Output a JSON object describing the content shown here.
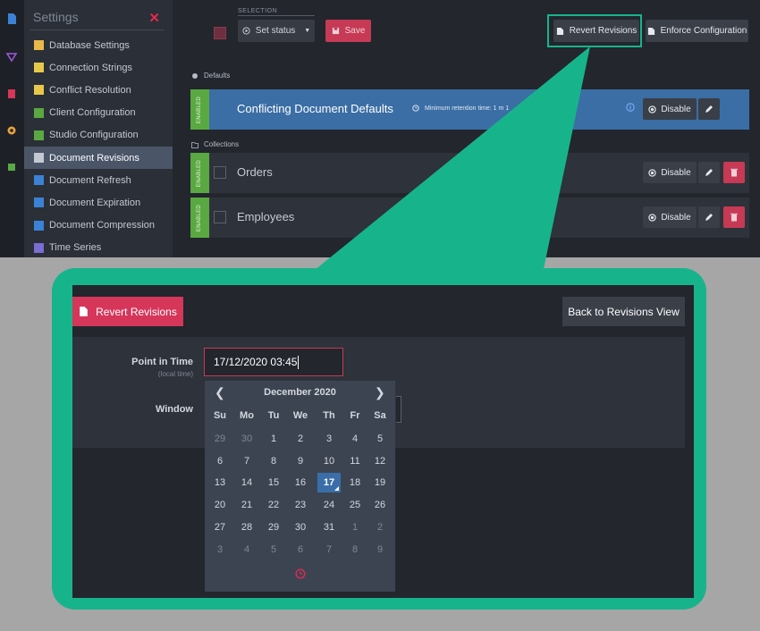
{
  "colors": {
    "accent_green": "#17b48c",
    "danger": "#d5365a",
    "enabled_green": "#5aa842",
    "selected_blue": "#3b6ea5",
    "bg_dark": "#23262d"
  },
  "settings_menu": {
    "title": "Settings",
    "close_icon": "close-icon",
    "items": [
      {
        "label": "Database Settings",
        "icon": "database-icon",
        "color": "#e8b84a"
      },
      {
        "label": "Connection Strings",
        "icon": "connection-icon",
        "color": "#e8c84a"
      },
      {
        "label": "Conflict Resolution",
        "icon": "conflict-icon",
        "color": "#e8c84a"
      },
      {
        "label": "Client Configuration",
        "icon": "client-icon",
        "color": "#5aa842"
      },
      {
        "label": "Studio Configuration",
        "icon": "studio-icon",
        "color": "#5aa842"
      },
      {
        "label": "Document Revisions",
        "icon": "revisions-icon",
        "color": "#c3c9d1",
        "active": true
      },
      {
        "label": "Document Refresh",
        "icon": "refresh-icon",
        "color": "#3b82d6"
      },
      {
        "label": "Document Expiration",
        "icon": "expiration-icon",
        "color": "#3b82d6"
      },
      {
        "label": "Document Compression",
        "icon": "compression-icon",
        "color": "#3b82d6"
      },
      {
        "label": "Time Series",
        "icon": "timeseries-icon",
        "color": "#7b6cd6"
      }
    ]
  },
  "toolbar": {
    "selection_label": "SELECTION",
    "set_status_label": "Set status",
    "save_label": "Save",
    "revert_revisions_label": "Revert Revisions",
    "enforce_configuration_label": "Enforce Configuration"
  },
  "defaults_section": {
    "label": "Defaults",
    "row": {
      "status": "ENABLED",
      "title": "Conflicting Document Defaults",
      "retention": "Minimum retention time: 1 m 1",
      "disable_label": "Disable"
    }
  },
  "collections_section": {
    "label": "Collections",
    "rows": [
      {
        "status": "ENABLED",
        "title": "Orders",
        "disable_label": "Disable"
      },
      {
        "status": "ENABLED",
        "title": "Employees",
        "disable_label": "Disable"
      }
    ]
  },
  "revert_view": {
    "revert_button_label": "Revert Revisions",
    "back_button_label": "Back to Revisions View",
    "point_in_time_label": "Point in Time",
    "point_in_time_sublabel": "(local time)",
    "point_in_time_value": "17/12/2020 03:45",
    "window_label": "Window"
  },
  "calendar": {
    "month_label": "December 2020",
    "weekdays": [
      "Su",
      "Mo",
      "Tu",
      "We",
      "Th",
      "Fr",
      "Sa"
    ],
    "weeks": [
      [
        {
          "d": "29",
          "m": true
        },
        {
          "d": "30",
          "m": true
        },
        {
          "d": "1"
        },
        {
          "d": "2"
        },
        {
          "d": "3"
        },
        {
          "d": "4"
        },
        {
          "d": "5"
        }
      ],
      [
        {
          "d": "6"
        },
        {
          "d": "7"
        },
        {
          "d": "8"
        },
        {
          "d": "9"
        },
        {
          "d": "10"
        },
        {
          "d": "11"
        },
        {
          "d": "12"
        }
      ],
      [
        {
          "d": "13"
        },
        {
          "d": "14"
        },
        {
          "d": "15"
        },
        {
          "d": "16"
        },
        {
          "d": "17",
          "s": true
        },
        {
          "d": "18"
        },
        {
          "d": "19"
        }
      ],
      [
        {
          "d": "20"
        },
        {
          "d": "21"
        },
        {
          "d": "22"
        },
        {
          "d": "23"
        },
        {
          "d": "24"
        },
        {
          "d": "25"
        },
        {
          "d": "26"
        }
      ],
      [
        {
          "d": "27"
        },
        {
          "d": "28"
        },
        {
          "d": "29"
        },
        {
          "d": "30"
        },
        {
          "d": "31"
        },
        {
          "d": "1",
          "m": true
        },
        {
          "d": "2",
          "m": true
        }
      ],
      [
        {
          "d": "3",
          "m": true
        },
        {
          "d": "4",
          "m": true
        },
        {
          "d": "5",
          "m": true
        },
        {
          "d": "6",
          "m": true
        },
        {
          "d": "7",
          "m": true
        },
        {
          "d": "8",
          "m": true
        },
        {
          "d": "9",
          "m": true
        }
      ]
    ],
    "prev_icon": "chevron-left-icon",
    "next_icon": "chevron-right-icon",
    "time_icon": "clock-icon"
  }
}
